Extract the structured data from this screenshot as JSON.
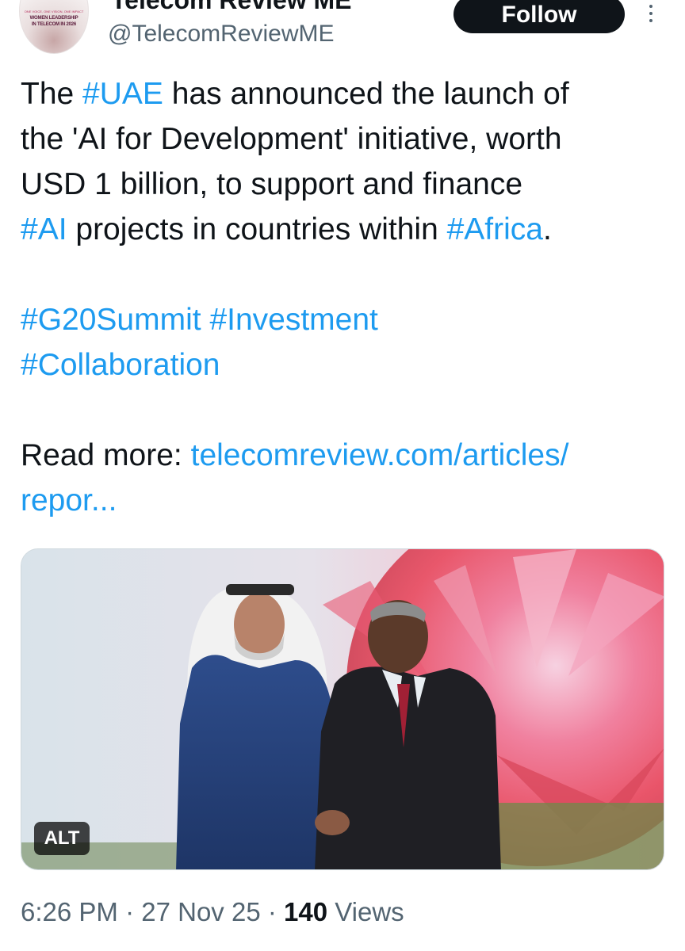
{
  "author": {
    "display_name": "Telecom Review ME",
    "handle": "@TelecomReviewME",
    "avatar": {
      "small_text": "ONE VOICE, ONE VISION, ONE IMPACT",
      "line1": "WOMEN LEADERSHIP",
      "line2": "IN TELECOM IN 2026"
    }
  },
  "follow_label": "Follow",
  "more_icon": "more-vertical-icon",
  "tweet": {
    "line1": {
      "t1": "The ",
      "h_uae": "#UAE",
      "t2": " has announced the launch of"
    },
    "line2": "the 'AI for Development' initiative, worth",
    "line3": "USD 1 billion, to support and finance",
    "line4": {
      "h_ai": "#AI",
      "t1": " projects in countries within ",
      "h_africa": "#Africa",
      "t2": "."
    },
    "line5": {
      "h_g20": "#G20Summit",
      "space": " ",
      "h_investment": "#Investment"
    },
    "line6": {
      "h_collab": "#Collaboration"
    },
    "line7": {
      "label": "Read more: ",
      "link": "telecomreview.com/articles/"
    },
    "line8": {
      "link": "repor..."
    }
  },
  "media": {
    "alt_label": "ALT"
  },
  "meta": {
    "time": "6:26 PM",
    "sep1": " · ",
    "date": "27 Nov 25",
    "sep2": " · ",
    "views_count": "140",
    "views_label": " Views"
  },
  "colors": {
    "link": "#1d9bf0",
    "text": "#0f1419",
    "secondary": "#536471",
    "button_bg": "#0f1419"
  }
}
